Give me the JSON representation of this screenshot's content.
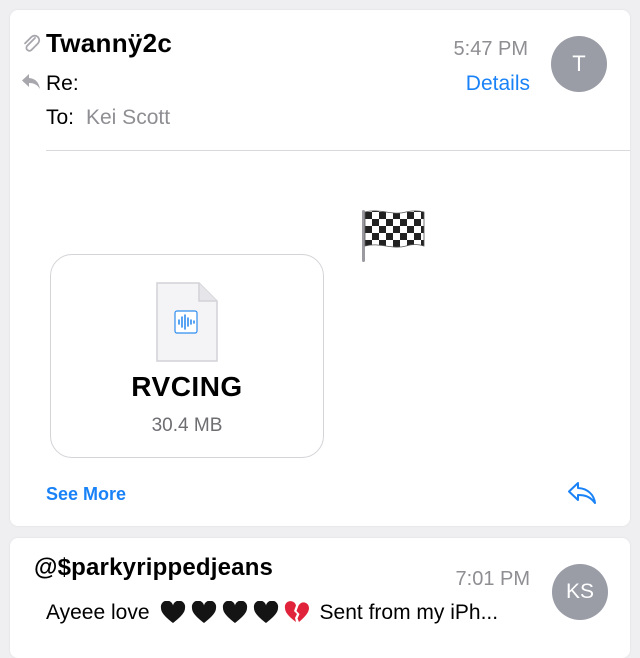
{
  "message": {
    "sender": "Twannÿ2c",
    "subject_label": "Re:",
    "to_label": "To:",
    "to_value": "Kei Scott",
    "time": "5:47 PM",
    "details_label": "Details",
    "avatar_initials": "T",
    "body_emoji": "🏁",
    "attachment": {
      "name": "RVCING",
      "size": "30.4 MB",
      "icon": "audio-file-icon"
    },
    "see_more_label": "See More"
  },
  "next_message": {
    "sender": "@$parkyrippedjeans",
    "time": "7:01 PM",
    "avatar_initials": "KS",
    "preview_prefix": "Ayeee love",
    "preview_emojis": [
      "🖤",
      "🖤",
      "🖤",
      "🖤",
      "💔"
    ],
    "preview_suffix": "Sent from my iPh..."
  },
  "colors": {
    "accent": "#1a82f7",
    "secondary_text": "#8e8e93",
    "avatar_bg": "#9a9ca6",
    "background": "#efeff1"
  }
}
